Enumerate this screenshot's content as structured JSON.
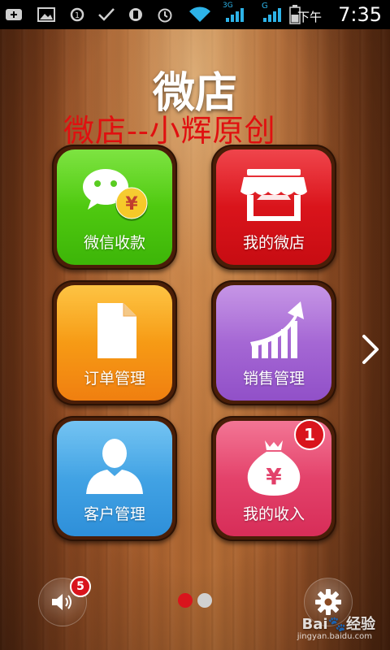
{
  "status_bar": {
    "ampm": "下午",
    "time": "7:35",
    "icons": [
      "add-icon",
      "image-icon",
      "sync-icon",
      "check-icon",
      "vibrate-icon",
      "alarm-icon",
      "wifi-icon",
      "signal-3g-icon",
      "signal-g-icon",
      "battery-icon"
    ],
    "network_3g": "3G",
    "network_g": "G"
  },
  "header": {
    "title": "微店",
    "subtitle": "微店--小辉原创"
  },
  "tiles": [
    {
      "label": "微信收款",
      "color": "#4cc80f",
      "icon": "wechat-pay-icon",
      "currency": "¥"
    },
    {
      "label": "我的微店",
      "color": "#dc151c",
      "icon": "storefront-icon"
    },
    {
      "label": "订单管理",
      "color": "#f79a14",
      "icon": "document-icon"
    },
    {
      "label": "销售管理",
      "color": "#a566d4",
      "icon": "sales-chart-icon"
    },
    {
      "label": "客户管理",
      "color": "#3fa1e4",
      "icon": "customer-icon"
    },
    {
      "label": "我的收入",
      "color": "#e23f69",
      "icon": "money-bag-icon",
      "currency": "¥",
      "badge": "1"
    }
  ],
  "navigation": {
    "next_icon": "chevron-right-icon",
    "page_dots": {
      "count": 2,
      "active": 1
    }
  },
  "bottom": {
    "sound_badge": "5",
    "sound_icon": "speaker-icon",
    "settings_icon": "gear-icon"
  },
  "watermark": {
    "brand": "Bai🐾经验",
    "url": "jingyan.baidu.com"
  }
}
